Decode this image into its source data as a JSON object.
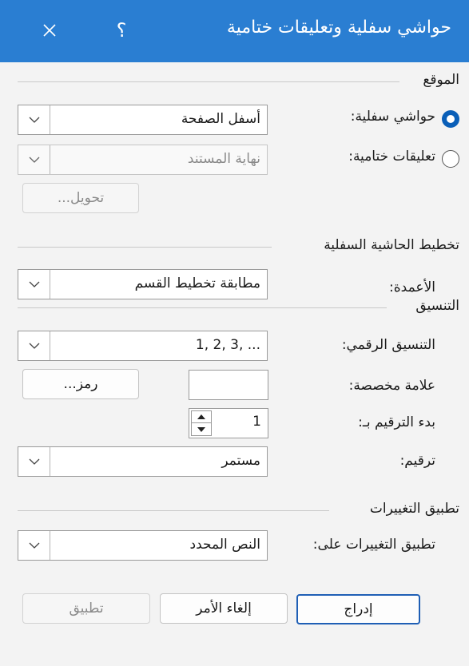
{
  "title": "حواشي سفلية وتعليقات ختامية",
  "help_label": "؟",
  "location": {
    "header": "الموقع",
    "footnotes_label": "حواشي سفلية:",
    "footnotes_value": "أسفل الصفحة",
    "endnotes_label": "تعليقات ختامية:",
    "endnotes_value": "نهاية المستند",
    "convert_button": "تحويل..."
  },
  "layout": {
    "header": "تخطيط الحاشية السفلية",
    "columns_label": "الأعمدة:",
    "columns_value": "مطابقة تخطيط القسم"
  },
  "format": {
    "header": "التنسيق",
    "number_format_label": "التنسيق الرقمي:",
    "number_format_value": "1, 2, 3, ...",
    "custom_mark_label": "علامة مخصصة:",
    "symbol_button": "رمز...",
    "start_at_label": "بدء الترقيم بـ:",
    "start_at_value": "1",
    "numbering_label": "ترقيم:",
    "numbering_value": "مستمر"
  },
  "apply": {
    "header": "تطبيق التغييرات",
    "apply_to_label": "تطبيق التغييرات على:",
    "apply_to_value": "النص المحدد"
  },
  "buttons": {
    "insert": "إدراج",
    "cancel": "إلغاء الأمر",
    "apply": "تطبيق"
  }
}
